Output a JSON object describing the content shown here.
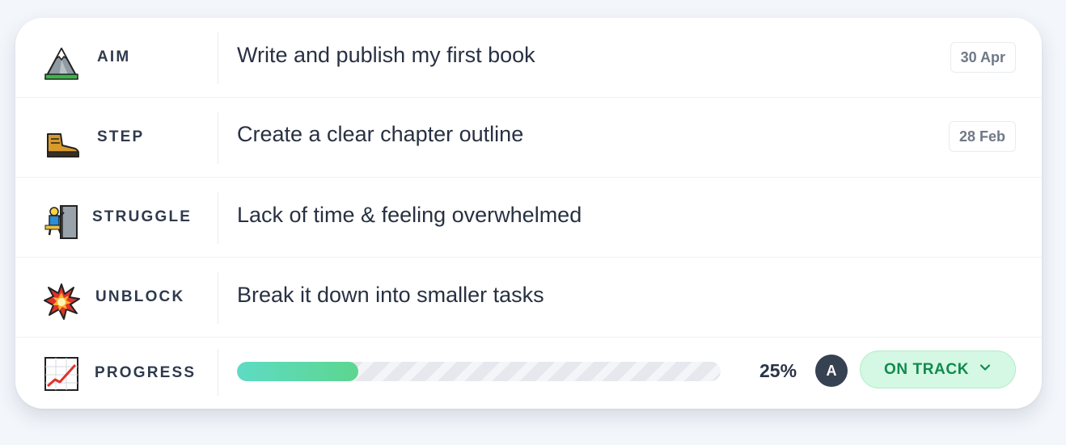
{
  "rows": [
    {
      "label": "AIM",
      "icon": "mountain-icon",
      "text": "Write and publish my first book",
      "date": "30 Apr"
    },
    {
      "label": "STEP",
      "icon": "boot-icon",
      "text": "Create a clear chapter outline",
      "date": "28 Feb"
    },
    {
      "label": "STRUGGLE",
      "icon": "climber-icon",
      "text": "Lack of time & feeling overwhelmed"
    },
    {
      "label": "UNBLOCK",
      "icon": "explosion-icon",
      "text": "Break it down into smaller tasks"
    }
  ],
  "progress": {
    "label": "PROGRESS",
    "icon": "chart-increasing-icon",
    "value": 0.25,
    "percent_text": "25%",
    "avatar_initial": "A",
    "status_label": "ON TRACK",
    "status_color": "#118a4e"
  }
}
